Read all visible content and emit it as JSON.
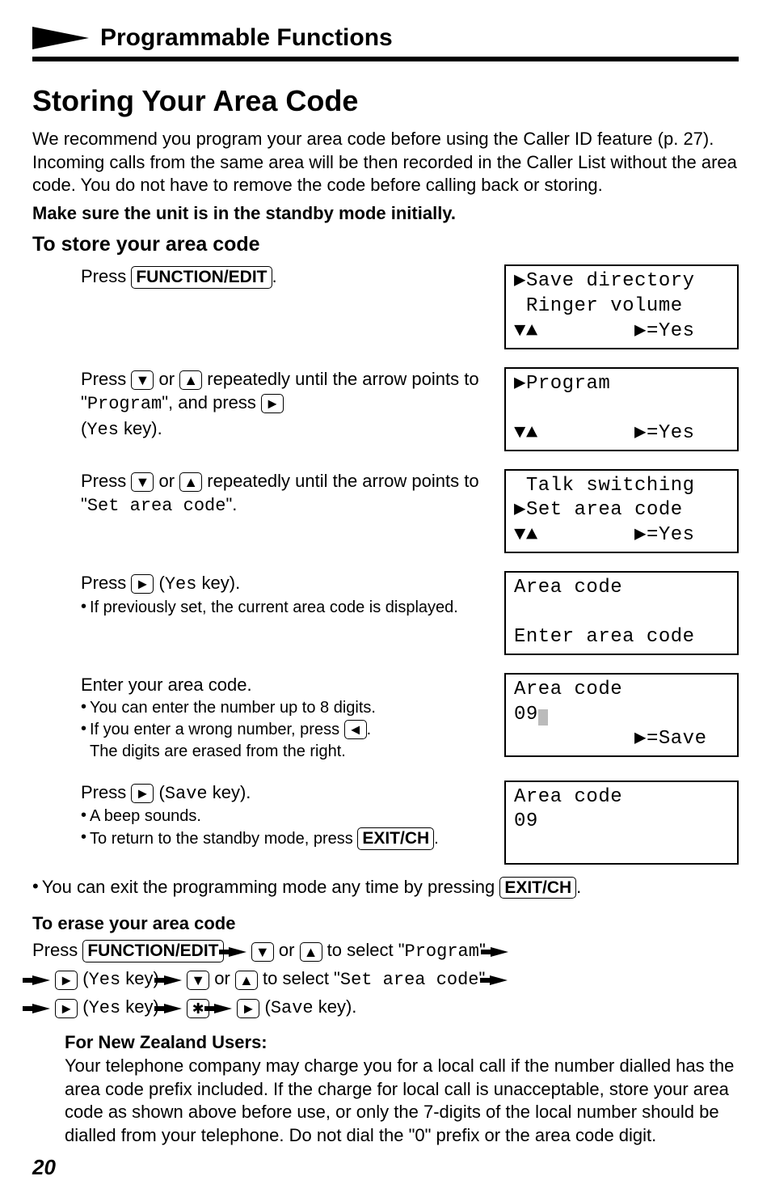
{
  "header": {
    "section": "Programmable Functions"
  },
  "title": "Storing Your Area Code",
  "intro": "We recommend you program your area code before using the Caller ID feature (p. 27). Incoming calls from the same area will be then recorded in the Caller List without the area code. You do not have to remove the code before calling back or storing.",
  "intro_bold": "Make sure the unit is in the standby mode initially.",
  "sub_heading": "To store your area code",
  "keys": {
    "function_edit": "FUNCTION/EDIT",
    "exit_ch": "EXIT/CH",
    "star": "✱"
  },
  "steps": [
    {
      "pre": "Press ",
      "key": "function_edit",
      "post": ".",
      "lcd": "▶Save directory\n Ringer volume\n▼▲        ▶=Yes"
    },
    {
      "line1_a": "Press ",
      "line1_b": " or ",
      "line1_c": " repeatedly until the arrow points to \"",
      "mono1": "Program",
      "line1_d": "\", and press ",
      "line2_a": "(",
      "mono2": "Yes",
      "line2_b": " key).",
      "lcd": "▶Program\n\n▼▲        ▶=Yes"
    },
    {
      "line1_a": "Press ",
      "line1_b": " or ",
      "line1_c": " repeatedly until the arrow points to \"",
      "mono1": "Set area code",
      "line1_d": "\".",
      "lcd": " Talk switching\n▶Set area code\n▼▲        ▶=Yes"
    },
    {
      "line1_a": "Press ",
      "line1_b": " (",
      "mono1": "Yes",
      "line1_c": " key).",
      "bullet": "If previously set, the current area code is displayed.",
      "lcd": "Area code\n\nEnter area code"
    },
    {
      "line1": "Enter your area code.",
      "b1": "You can enter the number up to 8 digits.",
      "b2a": "If you enter a wrong number, press ",
      "b2b": ".\nThe digits are erased from the right.",
      "lcd_line1": "Area code",
      "lcd_line2_pre": "09",
      "lcd_line3": "          ▶=Save"
    },
    {
      "line1_a": "Press ",
      "line1_b": " (",
      "mono1": "Save",
      "line1_c": " key).",
      "b1": "A beep sounds.",
      "b2a": "To return to the standby mode, press ",
      "b2b": ".",
      "lcd": "Area code\n09\n "
    }
  ],
  "exit_note_a": "You can exit the programming mode any time by pressing ",
  "exit_note_b": ".",
  "erase": {
    "heading": "To erase your area code",
    "l1a": "Press ",
    "l1b": " or ",
    "l1c": " to select \"",
    "mono1": "Program",
    "l1d": "\" ",
    "l2a": " (",
    "mono2": "Yes",
    "l2b": " key) ",
    "l2c": " or ",
    "l2d": " to select \"",
    "mono3": "Set area code",
    "l2e": "\" ",
    "l3a": " (",
    "mono4": "Yes",
    "l3b": " key) ",
    "l3c": " (",
    "mono5": "Save",
    "l3d": " key)."
  },
  "nz": {
    "heading": "For New Zealand Users:",
    "body": "Your telephone company may charge you for a local call if the number dialled has the area code prefix included. If the charge for local call is unacceptable, store your area code as shown above before use, or only the 7-digits of the local number should be dialled from your telephone. Do not dial the \"0\" prefix or the area code digit."
  },
  "page": "20"
}
